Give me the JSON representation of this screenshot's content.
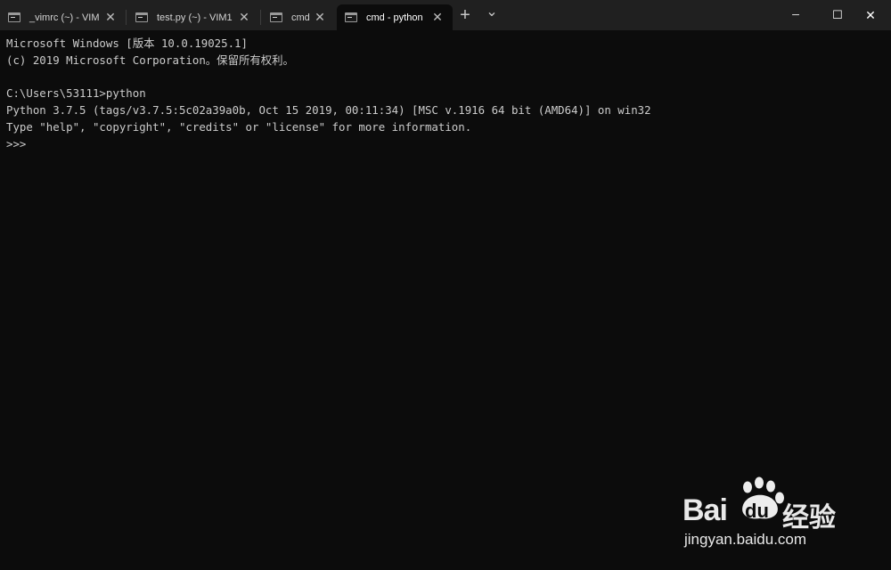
{
  "tabs": [
    {
      "label": "_vimrc (~) - VIM",
      "active": false
    },
    {
      "label": "test.py (~) - VIM1",
      "active": false
    },
    {
      "label": "cmd",
      "active": false
    },
    {
      "label": "cmd - python",
      "active": true
    }
  ],
  "new_tab": "+",
  "dropdown": "⌄",
  "window_controls": {
    "minimize": "─",
    "maximize": "☐",
    "close": "✕"
  },
  "terminal_lines": [
    "Microsoft Windows [版本 10.0.19025.1]",
    "(c) 2019 Microsoft Corporation。保留所有权利。",
    "",
    "C:\\Users\\53111>python",
    "Python 3.7.5 (tags/v3.7.5:5c02a39a0b, Oct 15 2019, 00:11:34) [MSC v.1916 64 bit (AMD64)] on win32",
    "Type \"help\", \"copyright\", \"credits\" or \"license\" for more information.",
    ">>>"
  ],
  "watermark": {
    "brand": "Bai",
    "brand_du": "du",
    "brand_cn": "经验",
    "url": "jingyan.baidu.com"
  },
  "colors": {
    "background": "#0c0c0c",
    "titlebar": "#202020",
    "text": "#cccccc"
  }
}
